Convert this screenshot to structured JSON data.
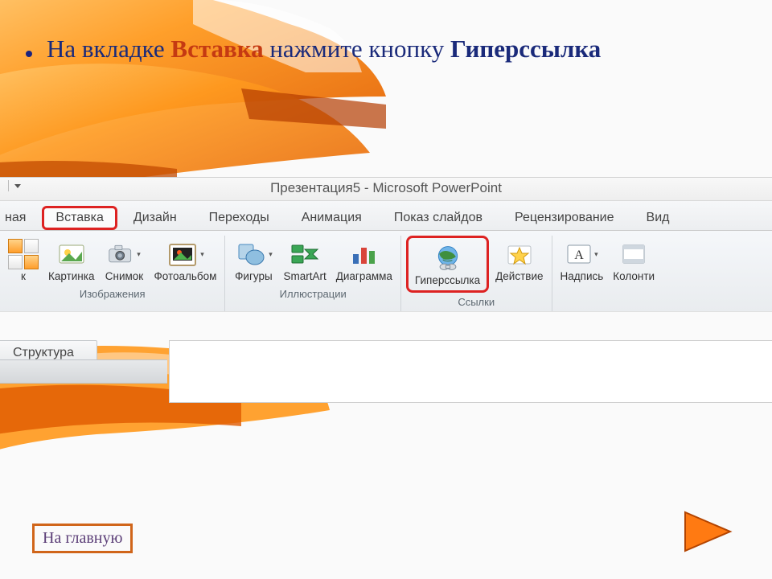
{
  "heading": {
    "part1": "На вкладке ",
    "em1": "Вставка",
    "part2": " нажмите кнопку ",
    "em2": "Гиперссылка"
  },
  "pp": {
    "title": "Презентация5 - Microsoft PowerPoint",
    "tabs": {
      "home_cut": "ная",
      "insert": "Вставка",
      "design": "Дизайн",
      "transitions": "Переходы",
      "animations": "Анимация",
      "slideshow": "Показ слайдов",
      "review": "Рецензирование",
      "view": "Вид"
    },
    "groups": {
      "images": {
        "label": "Изображения",
        "buttons": {
          "picture_cut": "к",
          "clipart": "Картинка",
          "screenshot": "Снимок",
          "album": "Фотоальбом"
        }
      },
      "illustrations": {
        "label": "Иллюстрации",
        "buttons": {
          "shapes": "Фигуры",
          "smartart": "SmartArt",
          "chart": "Диаграмма"
        }
      },
      "links": {
        "label": "Ссылки",
        "buttons": {
          "hyperlink": "Гиперссылка",
          "action": "Действие"
        }
      },
      "text": {
        "buttons": {
          "textbox": "Надпись",
          "headerfooter_cut": "Колонти"
        }
      }
    },
    "outline_tab": "Структура"
  },
  "nav": {
    "home": "На главную"
  }
}
